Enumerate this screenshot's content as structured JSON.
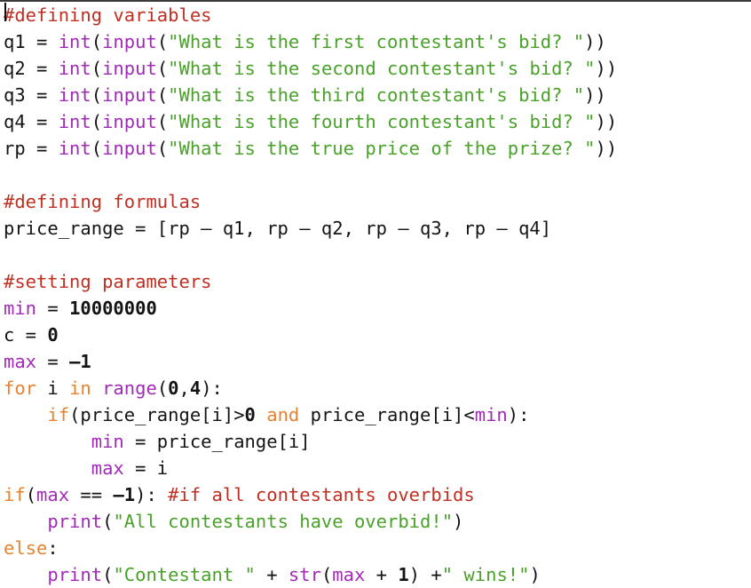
{
  "window": {
    "app": "code-editor",
    "title": "untitled python source",
    "background": "#ffffff"
  },
  "theme": {
    "comment_color": "#bf2f22",
    "string_color": "#49a12a",
    "builtin_color": "#a02bb5",
    "keyword_color": "#e8822f",
    "text_color": "#141414",
    "background_color": "#ffffff",
    "top_edge_color": "#3a3a3a"
  },
  "editor": {
    "language": "Python",
    "caret_line": 1,
    "caret_column": 1,
    "line_count": 22
  },
  "code": {
    "lines": [
      {
        "number": 1,
        "text": "#defining variables",
        "tokens": [
          {
            "t": "#defining variables",
            "c": "comment"
          }
        ]
      },
      {
        "number": 2,
        "text": "q1 = int(input(\"What is the first contestant's bid? \"))",
        "tokens": [
          {
            "t": "q1 = ",
            "c": "plain"
          },
          {
            "t": "int",
            "c": "builtin"
          },
          {
            "t": "(",
            "c": "plain"
          },
          {
            "t": "input",
            "c": "builtin"
          },
          {
            "t": "(",
            "c": "plain"
          },
          {
            "t": "\"What is the first contestant's bid? \"",
            "c": "string"
          },
          {
            "t": "))",
            "c": "plain"
          }
        ]
      },
      {
        "number": 3,
        "text": "q2 = int(input(\"What is the second contestant's bid? \"))",
        "tokens": [
          {
            "t": "q2 = ",
            "c": "plain"
          },
          {
            "t": "int",
            "c": "builtin"
          },
          {
            "t": "(",
            "c": "plain"
          },
          {
            "t": "input",
            "c": "builtin"
          },
          {
            "t": "(",
            "c": "plain"
          },
          {
            "t": "\"What is the second contestant's bid? \"",
            "c": "string"
          },
          {
            "t": "))",
            "c": "plain"
          }
        ]
      },
      {
        "number": 4,
        "text": "q3 = int(input(\"What is the third contestant's bid? \"))",
        "tokens": [
          {
            "t": "q3 = ",
            "c": "plain"
          },
          {
            "t": "int",
            "c": "builtin"
          },
          {
            "t": "(",
            "c": "plain"
          },
          {
            "t": "input",
            "c": "builtin"
          },
          {
            "t": "(",
            "c": "plain"
          },
          {
            "t": "\"What is the third contestant's bid? \"",
            "c": "string"
          },
          {
            "t": "))",
            "c": "plain"
          }
        ]
      },
      {
        "number": 5,
        "text": "q4 = int(input(\"What is the fourth contestant's bid? \"))",
        "tokens": [
          {
            "t": "q4 = ",
            "c": "plain"
          },
          {
            "t": "int",
            "c": "builtin"
          },
          {
            "t": "(",
            "c": "plain"
          },
          {
            "t": "input",
            "c": "builtin"
          },
          {
            "t": "(",
            "c": "plain"
          },
          {
            "t": "\"What is the fourth contestant's bid? \"",
            "c": "string"
          },
          {
            "t": "))",
            "c": "plain"
          }
        ]
      },
      {
        "number": 6,
        "text": "rp = int(input(\"What is the true price of the prize? \"))",
        "tokens": [
          {
            "t": "rp = ",
            "c": "plain"
          },
          {
            "t": "int",
            "c": "builtin"
          },
          {
            "t": "(",
            "c": "plain"
          },
          {
            "t": "input",
            "c": "builtin"
          },
          {
            "t": "(",
            "c": "plain"
          },
          {
            "t": "\"What is the true price of the prize? \"",
            "c": "string"
          },
          {
            "t": "))",
            "c": "plain"
          }
        ]
      },
      {
        "number": 7,
        "text": "",
        "tokens": []
      },
      {
        "number": 8,
        "text": "#defining formulas",
        "tokens": [
          {
            "t": "#defining formulas",
            "c": "comment"
          }
        ]
      },
      {
        "number": 9,
        "text": "price_range = [rp – q1, rp – q2, rp – q3, rp – q4]",
        "tokens": [
          {
            "t": "price_range = [rp – q1, rp – q2, rp – q3, rp – q4]",
            "c": "plain"
          }
        ]
      },
      {
        "number": 10,
        "text": "",
        "tokens": []
      },
      {
        "number": 11,
        "text": "#setting parameters",
        "tokens": [
          {
            "t": "#setting parameters",
            "c": "comment"
          }
        ]
      },
      {
        "number": 12,
        "text": "min = 10000000",
        "tokens": [
          {
            "t": "min",
            "c": "builtin"
          },
          {
            "t": " = ",
            "c": "plain"
          },
          {
            "t": "10000000",
            "c": "number"
          }
        ]
      },
      {
        "number": 13,
        "text": "c = 0",
        "tokens": [
          {
            "t": "c = ",
            "c": "plain"
          },
          {
            "t": "0",
            "c": "number"
          }
        ]
      },
      {
        "number": 14,
        "text": "max = –1",
        "tokens": [
          {
            "t": "max",
            "c": "builtin"
          },
          {
            "t": " = ",
            "c": "plain"
          },
          {
            "t": "–1",
            "c": "number"
          }
        ]
      },
      {
        "number": 15,
        "text": "for i in range(0,4):",
        "tokens": [
          {
            "t": "for",
            "c": "keyword"
          },
          {
            "t": " i ",
            "c": "plain"
          },
          {
            "t": "in",
            "c": "keyword"
          },
          {
            "t": " ",
            "c": "plain"
          },
          {
            "t": "range",
            "c": "builtin"
          },
          {
            "t": "(",
            "c": "plain"
          },
          {
            "t": "0",
            "c": "number"
          },
          {
            "t": ",",
            "c": "plain"
          },
          {
            "t": "4",
            "c": "number"
          },
          {
            "t": "):",
            "c": "plain"
          }
        ]
      },
      {
        "number": 16,
        "text": "    if(price_range[i]>0 and price_range[i]<min):",
        "tokens": [
          {
            "t": "    ",
            "c": "plain"
          },
          {
            "t": "if",
            "c": "keyword"
          },
          {
            "t": "(price_range[i]>",
            "c": "plain"
          },
          {
            "t": "0",
            "c": "number"
          },
          {
            "t": " ",
            "c": "plain"
          },
          {
            "t": "and",
            "c": "keyword"
          },
          {
            "t": " price_range[i]<",
            "c": "plain"
          },
          {
            "t": "min",
            "c": "builtin"
          },
          {
            "t": "):",
            "c": "plain"
          }
        ]
      },
      {
        "number": 17,
        "text": "        min = price_range[i]",
        "tokens": [
          {
            "t": "        ",
            "c": "plain"
          },
          {
            "t": "min",
            "c": "builtin"
          },
          {
            "t": " = price_range[i]",
            "c": "plain"
          }
        ]
      },
      {
        "number": 18,
        "text": "        max = i",
        "tokens": [
          {
            "t": "        ",
            "c": "plain"
          },
          {
            "t": "max",
            "c": "builtin"
          },
          {
            "t": " = i",
            "c": "plain"
          }
        ]
      },
      {
        "number": 19,
        "text": "if(max == –1): #if all contestants overbids",
        "tokens": [
          {
            "t": "if",
            "c": "keyword"
          },
          {
            "t": "(",
            "c": "plain"
          },
          {
            "t": "max",
            "c": "builtin"
          },
          {
            "t": " == ",
            "c": "plain"
          },
          {
            "t": "–1",
            "c": "number"
          },
          {
            "t": "): ",
            "c": "plain"
          },
          {
            "t": "#if all contestants overbids",
            "c": "comment"
          }
        ]
      },
      {
        "number": 20,
        "text": "    print(\"All contestants have overbid!\")",
        "tokens": [
          {
            "t": "    ",
            "c": "plain"
          },
          {
            "t": "print",
            "c": "builtin"
          },
          {
            "t": "(",
            "c": "plain"
          },
          {
            "t": "\"All contestants have overbid!\"",
            "c": "string"
          },
          {
            "t": ")",
            "c": "plain"
          }
        ]
      },
      {
        "number": 21,
        "text": "else:",
        "tokens": [
          {
            "t": "else",
            "c": "keyword"
          },
          {
            "t": ":",
            "c": "plain"
          }
        ]
      },
      {
        "number": 22,
        "text": "    print(\"Contestant \" + str(max + 1) +\" wins!\")",
        "tokens": [
          {
            "t": "    ",
            "c": "plain"
          },
          {
            "t": "print",
            "c": "builtin"
          },
          {
            "t": "(",
            "c": "plain"
          },
          {
            "t": "\"Contestant \"",
            "c": "string"
          },
          {
            "t": " + ",
            "c": "plain"
          },
          {
            "t": "str",
            "c": "builtin"
          },
          {
            "t": "(",
            "c": "plain"
          },
          {
            "t": "max",
            "c": "builtin"
          },
          {
            "t": " + ",
            "c": "plain"
          },
          {
            "t": "1",
            "c": "number"
          },
          {
            "t": ") +",
            "c": "plain"
          },
          {
            "t": "\" wins!\"",
            "c": "string"
          },
          {
            "t": ")",
            "c": "plain"
          }
        ]
      }
    ]
  }
}
